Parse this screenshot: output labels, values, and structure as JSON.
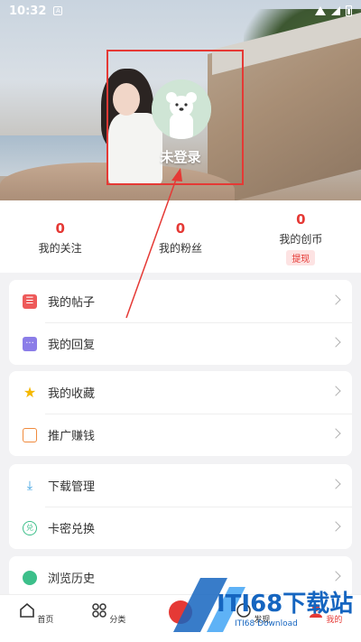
{
  "status_bar": {
    "time": "10:32",
    "app_badge": "A"
  },
  "header": {
    "login_text": "未登录"
  },
  "stats": [
    {
      "value": "0",
      "label": "我的关注"
    },
    {
      "value": "0",
      "label": "我的粉丝"
    },
    {
      "value": "0",
      "label": "我的创币",
      "action": "提现"
    }
  ],
  "menu": {
    "group1": [
      {
        "label": "我的帖子",
        "icon": "post-icon",
        "color": "#ee5a5a"
      },
      {
        "label": "我的回复",
        "icon": "reply-icon",
        "color": "#8b7de8"
      }
    ],
    "group2": [
      {
        "label": "我的收藏",
        "icon": "star-icon",
        "color": "#f5b800"
      },
      {
        "label": "推广赚钱",
        "icon": "gift-icon",
        "color": "#f08a3c"
      }
    ],
    "group3": [
      {
        "label": "下载管理",
        "icon": "download-icon",
        "color": "#3aa0e0"
      },
      {
        "label": "卡密兑换",
        "icon": "exchange-icon",
        "color": "#3cbf8a"
      }
    ],
    "group4": [
      {
        "label": "浏览历史",
        "icon": "clock-icon",
        "color": "#3cbf8a"
      }
    ]
  },
  "bottom_nav": [
    {
      "label": "首页",
      "icon": "home-icon"
    },
    {
      "label": "分类",
      "icon": "grid-icon"
    },
    {
      "label": "",
      "icon": "center-icon"
    },
    {
      "label": "发现",
      "icon": "discover-icon"
    },
    {
      "label": "我的",
      "icon": "profile-icon",
      "active": true
    }
  ],
  "watermark": {
    "brand": "ITI68下载站",
    "sub": "ITI68 Download"
  },
  "colors": {
    "accent": "#e53935"
  }
}
